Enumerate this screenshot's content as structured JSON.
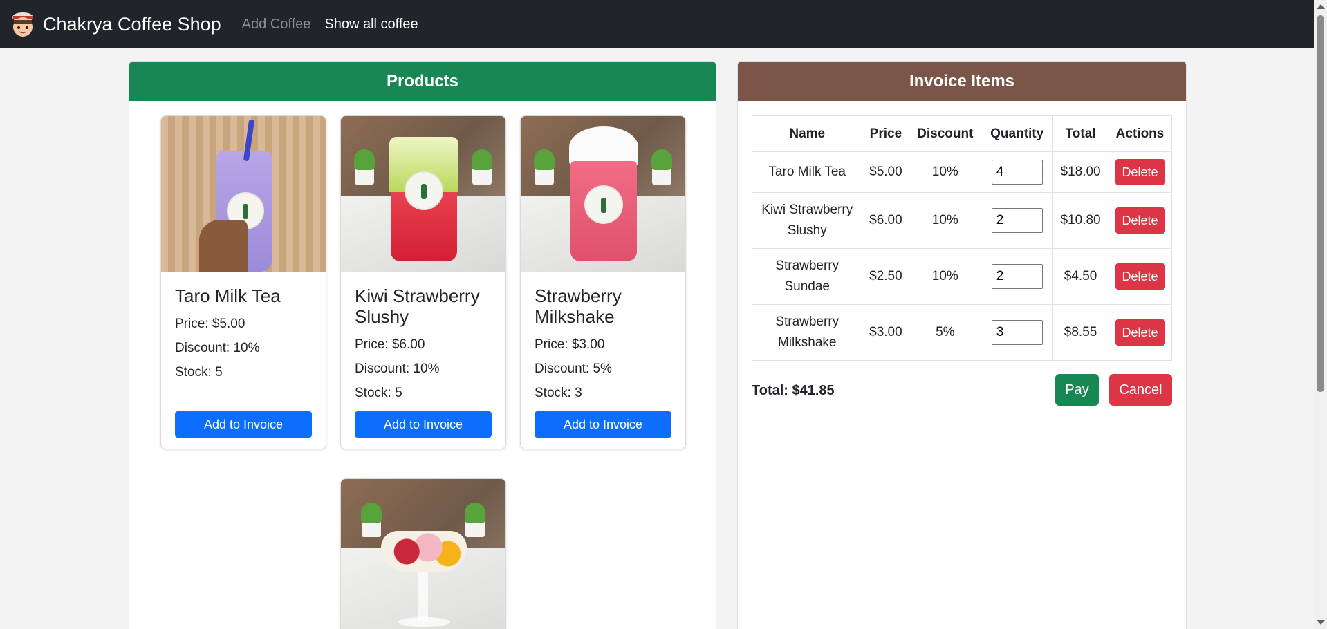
{
  "navbar": {
    "brand": "Chakrya Coffee Shop",
    "links": [
      "Add Coffee",
      "Show all coffee"
    ]
  },
  "products": {
    "title": "Products",
    "price_prefix": "Price: ",
    "discount_prefix": "Discount: ",
    "stock_prefix": "Stock: ",
    "add_label": "Add to Invoice",
    "items": [
      {
        "name": "Taro Milk Tea",
        "price": "$5.00",
        "discount": "10%",
        "stock": "5"
      },
      {
        "name": "Kiwi Strawberry Slushy",
        "price": "$6.00",
        "discount": "10%",
        "stock": "5"
      },
      {
        "name": "Strawberry Milkshake",
        "price": "$3.00",
        "discount": "5%",
        "stock": "3"
      }
    ]
  },
  "invoice": {
    "title": "Invoice Items",
    "columns": [
      "Name",
      "Price",
      "Discount",
      "Quantity",
      "Total",
      "Actions"
    ],
    "delete_label": "Delete",
    "rows": [
      {
        "name": "Taro Milk Tea",
        "price": "$5.00",
        "discount": "10%",
        "quantity": "4",
        "total": "$18.00"
      },
      {
        "name": "Kiwi Strawberry Slushy",
        "price": "$6.00",
        "discount": "10%",
        "quantity": "2",
        "total": "$10.80"
      },
      {
        "name": "Strawberry Sundae",
        "price": "$2.50",
        "discount": "10%",
        "quantity": "2",
        "total": "$4.50"
      },
      {
        "name": "Strawberry Milkshake",
        "price": "$3.00",
        "discount": "5%",
        "quantity": "3",
        "total": "$8.55"
      }
    ],
    "total": "Total: $41.85",
    "pay_label": "Pay",
    "cancel_label": "Cancel"
  },
  "colors": {
    "navbar": "#212529",
    "products_header": "#198754",
    "invoice_header": "#7a5548",
    "primary_button": "#0d6efd",
    "danger_button": "#dc3545",
    "success_button": "#198754"
  },
  "icons": [
    "coffee-shop-logo-icon"
  ]
}
